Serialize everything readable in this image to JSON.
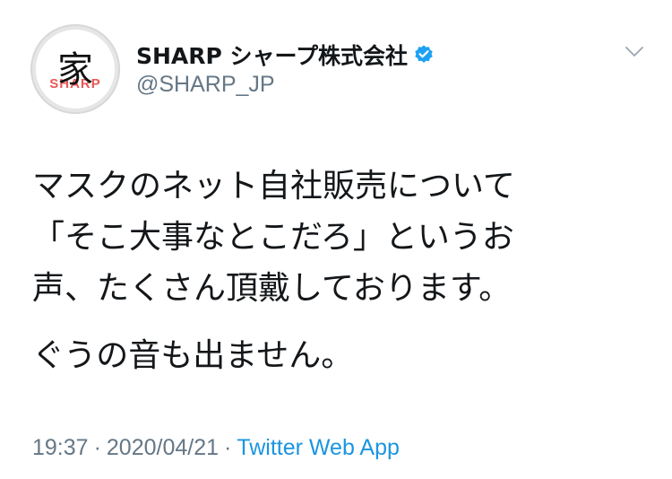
{
  "user": {
    "display_name": "SHARP シャープ株式会社",
    "handle": "@SHARP_JP",
    "avatar_glyph": "家",
    "avatar_brand": "SHARP",
    "verified": true,
    "verified_icon": "verified-badge-icon",
    "verified_color": "#1da1f2"
  },
  "menu": {
    "icon": "chevron-down-icon"
  },
  "tweet": {
    "lines": [
      "マスクのネット自社販売について",
      "「そこ大事なとこだろ」というお",
      "声、たくさん頂戴しております。"
    ],
    "second_paragraph": "ぐうの音も出ません。"
  },
  "meta": {
    "time": "19:37",
    "separator": "·",
    "date": "2020/04/21",
    "source": "Twitter Web App",
    "source_color": "#1b95e0"
  }
}
